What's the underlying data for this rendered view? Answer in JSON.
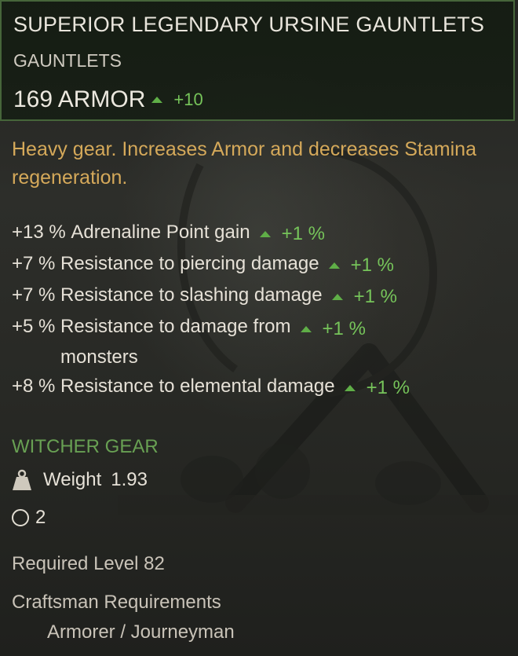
{
  "item": {
    "name": "SUPERIOR LEGENDARY URSINE GAUNTLETS",
    "type": "GAUNTLETS",
    "armor": "169 ARMOR",
    "armor_bonus": "+10"
  },
  "description": "Heavy gear. Increases Armor and decreases Stamina regeneration.",
  "stats": [
    {
      "value": "+13 %",
      "text": "Adrenaline Point gain",
      "bonus": "+1 %"
    },
    {
      "value": "+7 %",
      "text": "Resistance to piercing damage",
      "bonus": "+1 %"
    },
    {
      "value": "+7 %",
      "text": "Resistance to slashing damage",
      "bonus": "+1 %"
    },
    {
      "value": "+5 %",
      "text": "Resistance to damage from",
      "text2": "monsters",
      "bonus": "+1 %"
    },
    {
      "value": "+8 %",
      "text": "Resistance to elemental damage",
      "bonus": "+1 %"
    }
  ],
  "set_name": "WITCHER GEAR",
  "weight": {
    "label": "Weight",
    "value": "1.93",
    "icon": "weight-icon"
  },
  "sockets": {
    "count": "2",
    "icon": "socket-icon"
  },
  "required_level": "Required Level 82",
  "crafting": {
    "title": "Craftsman Requirements",
    "value": "Armorer / Journeyman"
  },
  "colors": {
    "header_border": "#46653a",
    "description": "#d5a95a",
    "bonus_green": "#76c45a",
    "set_green": "#68a053"
  }
}
